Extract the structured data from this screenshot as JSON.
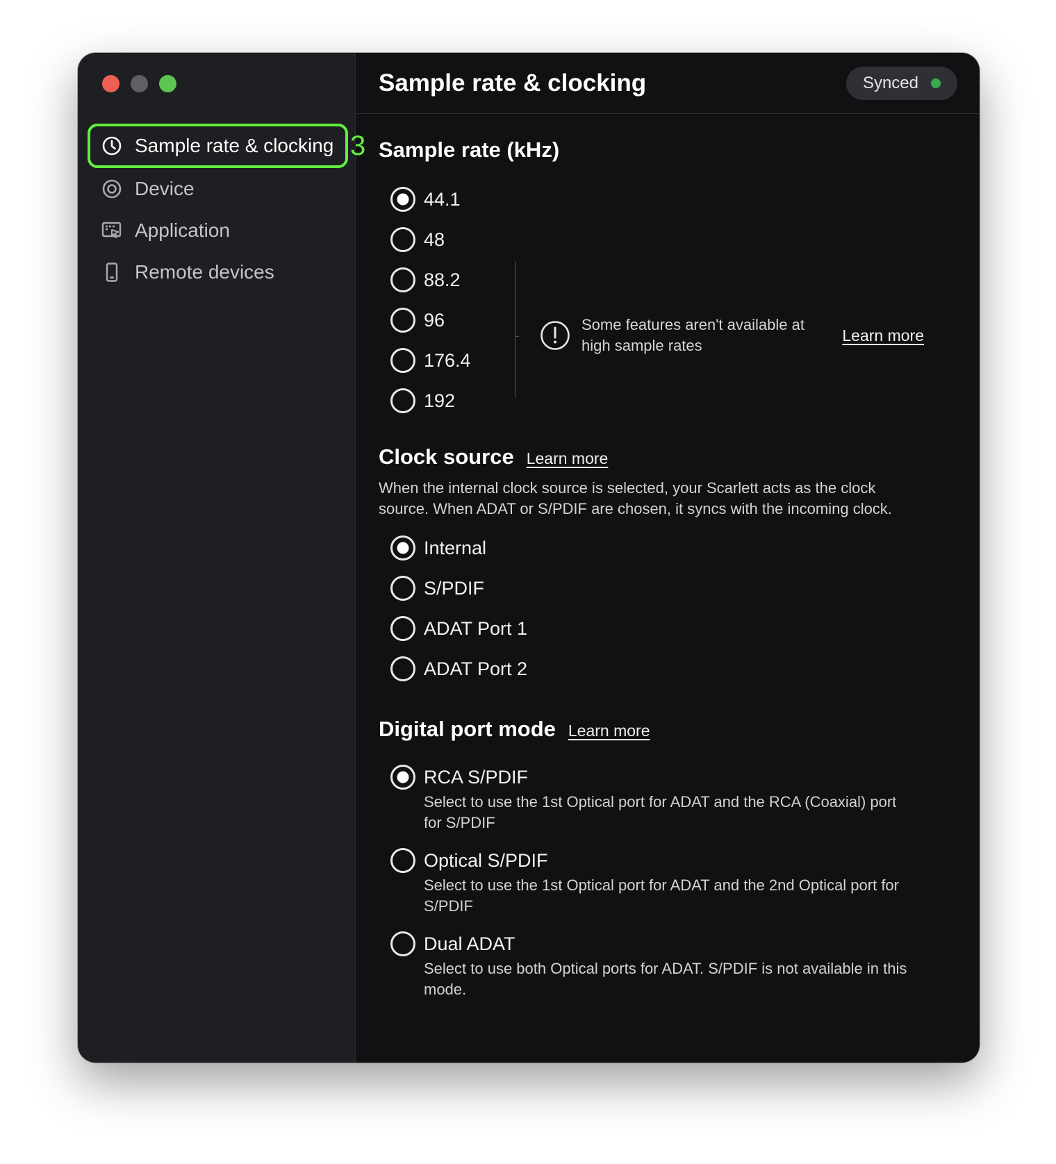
{
  "sidebar": {
    "items": [
      {
        "label": "Sample rate & clocking",
        "icon": "clock-icon",
        "active": true
      },
      {
        "label": "Device",
        "icon": "device-icon",
        "active": false
      },
      {
        "label": "Application",
        "icon": "application-icon",
        "active": false
      },
      {
        "label": "Remote devices",
        "icon": "phone-icon",
        "active": false
      }
    ],
    "callout_number": "3",
    "callout_color": "#60f03c"
  },
  "header": {
    "title": "Sample rate & clocking",
    "status_label": "Synced",
    "status_color": "#3aa94f"
  },
  "sample_rate": {
    "title": "Sample rate (kHz)",
    "options": [
      "44.1",
      "48",
      "88.2",
      "96",
      "176.4",
      "192"
    ],
    "selected": "44.1",
    "warning": "Some features aren't available at high sample rates",
    "learn_more": "Learn more"
  },
  "clock_source": {
    "title": "Clock source",
    "learn_more": "Learn more",
    "description": "When the internal clock source is selected, your Scarlett acts as the clock source. When ADAT or S/PDIF are chosen, it syncs with the incoming clock.",
    "options": [
      "Internal",
      "S/PDIF",
      "ADAT Port 1",
      "ADAT Port 2"
    ],
    "selected": "Internal"
  },
  "digital_port_mode": {
    "title": "Digital port mode",
    "learn_more": "Learn more",
    "options": [
      {
        "label": "RCA S/PDIF",
        "description": "Select to use the 1st Optical port for ADAT and the RCA (Coaxial) port for S/PDIF"
      },
      {
        "label": "Optical S/PDIF",
        "description": "Select to use the 1st Optical port for ADAT and the 2nd Optical port for S/PDIF"
      },
      {
        "label": "Dual ADAT",
        "description": "Select to use both Optical ports for ADAT. S/PDIF is not available in this mode."
      }
    ],
    "selected": "RCA S/PDIF"
  }
}
